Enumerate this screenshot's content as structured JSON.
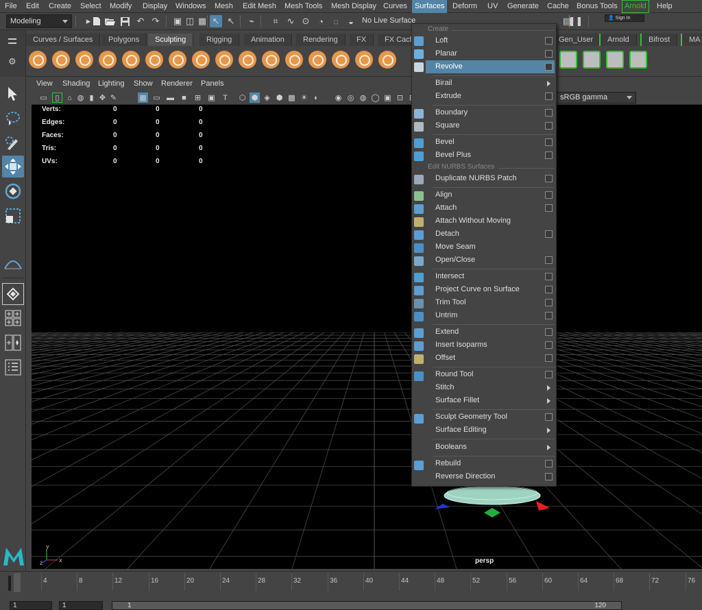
{
  "menubar": {
    "items": [
      "File",
      "Edit",
      "Create",
      "Select",
      "Modify",
      "Display",
      "Windows",
      "Mesh",
      "Edit Mesh",
      "Mesh Tools",
      "Mesh Display",
      "Curves",
      "Surfaces",
      "Deform",
      "UV",
      "Generate",
      "Cache",
      "Bonus Tools",
      "Arnold",
      "Help"
    ],
    "active": "Surfaces"
  },
  "statusline": {
    "mode": "Modeling",
    "live_surface": "No Live Surface",
    "sign_in": "Sign In"
  },
  "shelf": {
    "tabs": [
      "Curves / Surfaces",
      "Polygons",
      "Sculpting",
      "Rigging",
      "Animation",
      "Rendering",
      "FX",
      "FX Cach",
      "Gen_User",
      "Arnold",
      "Bifrost",
      "MA"
    ],
    "active_tab": "Sculpting"
  },
  "panel": {
    "menus": [
      "View",
      "Shading",
      "Lighting",
      "Show",
      "Renderer",
      "Panels"
    ],
    "color_space": "sRGB gamma",
    "camera": "persp"
  },
  "hud": {
    "rows": [
      {
        "label": "Verts:",
        "values": [
          "0",
          "0",
          "0"
        ]
      },
      {
        "label": "Edges:",
        "values": [
          "0",
          "0",
          "0"
        ]
      },
      {
        "label": "Faces:",
        "values": [
          "0",
          "0",
          "0"
        ]
      },
      {
        "label": "Tris:",
        "values": [
          "0",
          "0",
          "0"
        ]
      },
      {
        "label": "UVs:",
        "values": [
          "0",
          "0",
          "0"
        ]
      }
    ]
  },
  "surfaces_menu": {
    "section_create": "Create",
    "section_edit": "Edit NURBS Surfaces",
    "items": [
      {
        "label": "Loft",
        "option": true,
        "submenu": false
      },
      {
        "label": "Planar",
        "option": true,
        "submenu": false
      },
      {
        "label": "Revolve",
        "option": true,
        "submenu": false,
        "highlighted": true
      },
      {
        "label": "Birail",
        "option": false,
        "submenu": true
      },
      {
        "label": "Extrude",
        "option": true,
        "submenu": false
      },
      {
        "label": "Boundary",
        "option": true,
        "submenu": false
      },
      {
        "label": "Square",
        "option": true,
        "submenu": false
      },
      {
        "label": "Bevel",
        "option": true,
        "submenu": false
      },
      {
        "label": "Bevel Plus",
        "option": true,
        "submenu": false
      },
      {
        "label": "Duplicate NURBS Patch",
        "option": true,
        "submenu": false
      },
      {
        "label": "Align",
        "option": true,
        "submenu": false
      },
      {
        "label": "Attach",
        "option": true,
        "submenu": false
      },
      {
        "label": "Attach Without Moving",
        "option": false,
        "submenu": false
      },
      {
        "label": "Detach",
        "option": true,
        "submenu": false
      },
      {
        "label": "Move Seam",
        "option": false,
        "submenu": false
      },
      {
        "label": "Open/Close",
        "option": true,
        "submenu": false
      },
      {
        "label": "Intersect",
        "option": true,
        "submenu": false
      },
      {
        "label": "Project Curve on Surface",
        "option": true,
        "submenu": false
      },
      {
        "label": "Trim Tool",
        "option": true,
        "submenu": false
      },
      {
        "label": "Untrim",
        "option": true,
        "submenu": false
      },
      {
        "label": "Extend",
        "option": true,
        "submenu": false
      },
      {
        "label": "Insert Isoparms",
        "option": true,
        "submenu": false
      },
      {
        "label": "Offset",
        "option": true,
        "submenu": false
      },
      {
        "label": "Round Tool",
        "option": true,
        "submenu": false
      },
      {
        "label": "Stitch",
        "option": false,
        "submenu": true
      },
      {
        "label": "Surface Fillet",
        "option": false,
        "submenu": true
      },
      {
        "label": "Sculpt Geometry Tool",
        "option": true,
        "submenu": false
      },
      {
        "label": "Surface Editing",
        "option": false,
        "submenu": true
      },
      {
        "label": "Booleans",
        "option": false,
        "submenu": true
      },
      {
        "label": "Rebuild",
        "option": true,
        "submenu": false
      },
      {
        "label": "Reverse Direction",
        "option": true,
        "submenu": false
      }
    ]
  },
  "timeslider": {
    "ticks": [
      "4",
      "8",
      "12",
      "16",
      "20",
      "24",
      "28",
      "32",
      "36",
      "40",
      "44",
      "48",
      "52",
      "56",
      "60",
      "64",
      "68",
      "72",
      "76"
    ],
    "current_frame": "1"
  },
  "rangebar": {
    "start": "1",
    "anim_start": "1",
    "range_start": "1",
    "range_end": "120"
  },
  "colors": {
    "highlight": "#5285a6",
    "arnold_green": "#2fc52f",
    "shelf_orange": "#e7974a"
  }
}
